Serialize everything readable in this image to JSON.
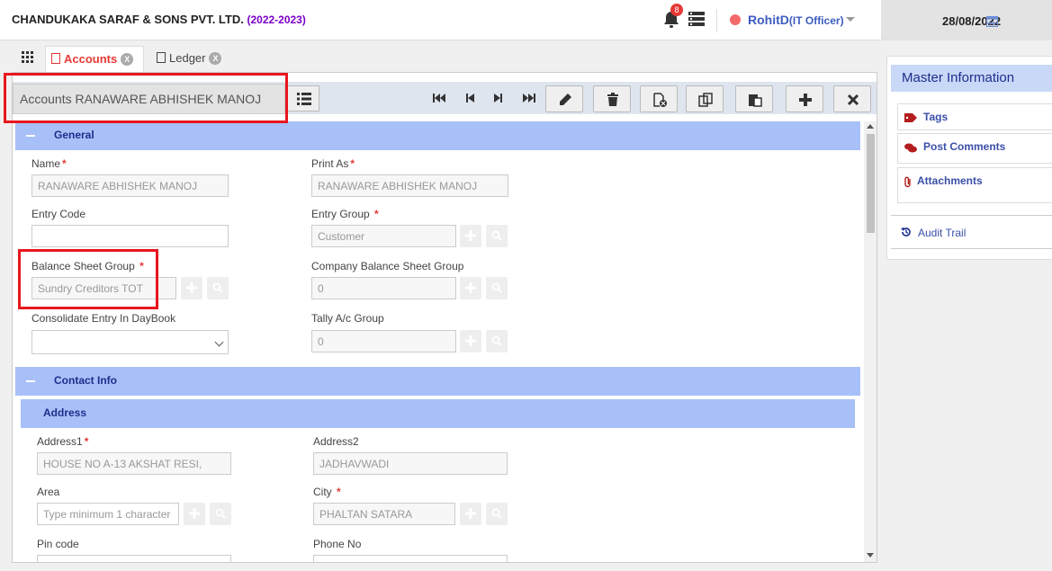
{
  "header": {
    "company": "CHANDUKAKA SARAF & SONS PVT. LTD.",
    "year": "(2022-2023)",
    "notification_count": "8",
    "user_name": "RohitD",
    "user_role": "(IT Officer)",
    "date": "28/08/2022",
    "status_color": "#f46a6a"
  },
  "tabs": [
    {
      "label": "Accounts",
      "close": "X",
      "active": true
    },
    {
      "label": "Ledger",
      "close": "X",
      "active": false
    }
  ],
  "toolbar": {
    "title": "Accounts RANAWARE ABHISHEK MANOJ"
  },
  "sections": {
    "general": "General",
    "contact": "Contact Info",
    "address": "Address"
  },
  "form": {
    "name_label": "Name",
    "name_value": "RANAWARE ABHISHEK MANOJ",
    "print_as_label": "Print As",
    "print_as_value": "RANAWARE ABHISHEK MANOJ",
    "entry_code_label": "Entry Code",
    "entry_code_value": "",
    "entry_group_label": "Entry Group",
    "entry_group_value": "Customer",
    "bsg_label": "Balance Sheet Group",
    "bsg_value": "Sundry Creditors TOT",
    "cbsg_label": "Company Balance Sheet Group",
    "cbsg_value": "0",
    "consolidate_label": "Consolidate Entry In DayBook",
    "consolidate_value": "",
    "tally_label": "Tally A/c Group",
    "tally_value": "0",
    "address1_label": "Address1",
    "address1_value": "HOUSE NO A-13 AKSHAT RESI,",
    "address2_label": "Address2",
    "address2_value": "JADHAVWADI",
    "area_label": "Area",
    "area_placeholder": "Type minimum 1 character",
    "city_label": "City",
    "city_value": "PHALTAN  SATARA",
    "pincode_label": "Pin code",
    "phone_label": "Phone No"
  },
  "master_info": {
    "title": "Master Information",
    "tags": "Tags",
    "comments": "Post Comments",
    "attachments": "Attachments",
    "audit": "Audit Trail"
  },
  "colors": {
    "accent": "#3d5dc0",
    "section_bg": "#a8c0f8",
    "highlight": "#e8161e"
  }
}
